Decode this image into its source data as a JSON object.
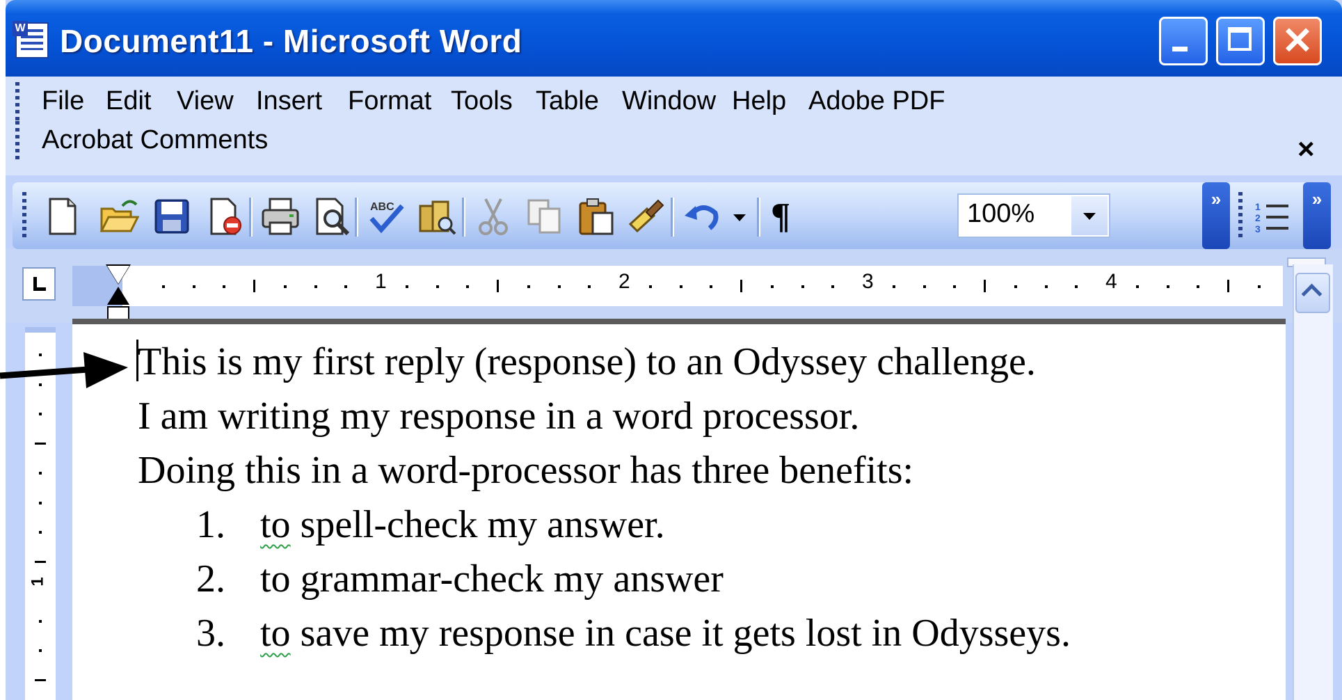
{
  "window": {
    "title": "Document11 - Microsoft Word"
  },
  "menubar": {
    "items": [
      "File",
      "Edit",
      "View",
      "Insert",
      "Format",
      "Tools",
      "Table",
      "Window",
      "Help",
      "Adobe PDF"
    ],
    "second_row": "Acrobat Comments",
    "close_glyph": "×"
  },
  "toolbar": {
    "buttons": [
      "new-icon",
      "open-icon",
      "save-icon",
      "permission-icon",
      "print-icon",
      "print-preview-icon",
      "spelling-icon",
      "research-icon",
      "cut-icon",
      "copy-icon",
      "paste-icon",
      "format-painter-icon",
      "undo-icon",
      "show-formatting-icon",
      "numbering-icon"
    ],
    "zoom": "100%",
    "pilcrow": "¶"
  },
  "ruler": {
    "numbers": [
      "1",
      "2",
      "3",
      "4"
    ],
    "vertical_number": "1"
  },
  "document": {
    "lines": [
      "This is my first reply (response) to an Odyssey challenge.",
      "I am writing my response in a word processor.",
      "Doing this in a word-processor has three benefits:"
    ],
    "list": [
      {
        "num": "1.",
        "first_word": "to",
        "rest": " spell-check my answer."
      },
      {
        "num": "2.",
        "first_word": "to",
        "rest": " grammar-check my answer"
      },
      {
        "num": "3.",
        "first_word": "to",
        "rest": " save my response in case it gets lost in Odysseys."
      }
    ]
  },
  "colors": {
    "titlebar": "#0553d6",
    "menubar": "#d6e3fb",
    "close_button": "#d84a20"
  }
}
